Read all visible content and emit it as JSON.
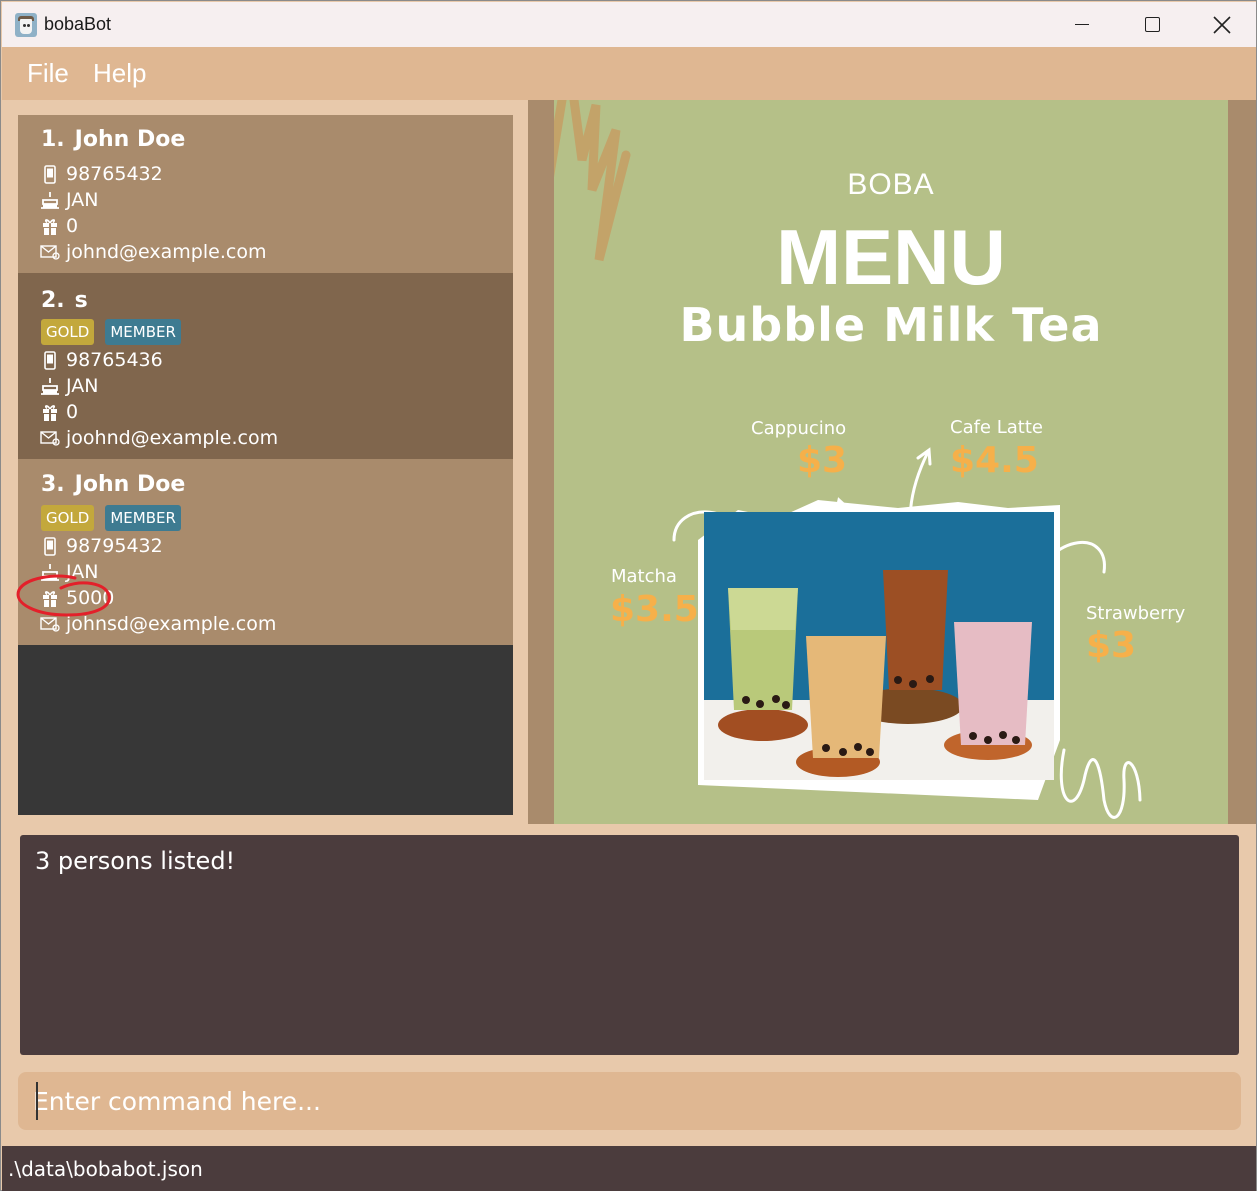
{
  "window": {
    "title": "bobaBot",
    "controls": [
      "minimize",
      "maximize",
      "close"
    ]
  },
  "menu": {
    "file": "File",
    "help": "Help"
  },
  "persons": [
    {
      "index": "1.",
      "name": "John Doe",
      "tags": [],
      "phone": "98765432",
      "birthday": "JAN",
      "points": "0",
      "email": "johnd@example.com"
    },
    {
      "index": "2.",
      "name": "s",
      "tags": [
        "GOLD",
        "MEMBER"
      ],
      "phone": "98765436",
      "birthday": "JAN",
      "points": "0",
      "email": "joohnd@example.com"
    },
    {
      "index": "3.",
      "name": "John Doe",
      "tags": [
        "GOLD",
        "MEMBER"
      ],
      "phone": "98795432",
      "birthday": "JAN",
      "points": "5000",
      "email": "johnsd@example.com"
    }
  ],
  "icons": {
    "phone": "phone-icon",
    "birthday": "cake-icon",
    "points": "gift-icon",
    "email": "mail-icon"
  },
  "poster": {
    "eyebrow": "BOBA",
    "title": "MENU",
    "subtitle": "Bubble Milk Tea",
    "items": [
      {
        "name": "Cappucino",
        "price": "$3"
      },
      {
        "name": "Cafe Latte",
        "price": "$4.5"
      },
      {
        "name": "Matcha",
        "price": "$3.5"
      },
      {
        "name": "Strawberry",
        "price": "$3"
      }
    ]
  },
  "result": {
    "message": "3 persons listed!"
  },
  "command": {
    "placeholder": "Enter command here..."
  },
  "status": {
    "path": ".\\data\\bobabot.json"
  },
  "colors": {
    "menu_bar": "#dfb792",
    "card_light": "#a98b6c",
    "card_dark": "#80664d",
    "tag_gold": "#c3a83c",
    "tag_member": "#3e7b91",
    "result_bg": "#4b3c3d",
    "annotation": "#e3202a"
  }
}
